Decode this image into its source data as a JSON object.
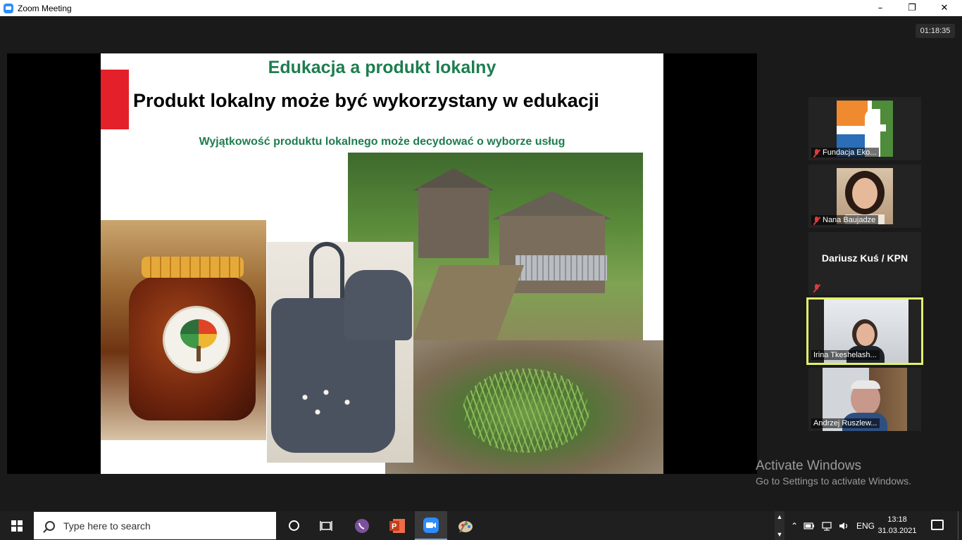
{
  "window": {
    "title": "Zoom Meeting",
    "minimize_icon": "minimize-icon",
    "restore_icon": "restore-icon",
    "close_icon": "close-icon"
  },
  "meeting": {
    "timer": "01:18:35"
  },
  "slide": {
    "title": "Edukacja a produkt lokalny",
    "heading": "Produkt lokalny może być wykorzystany w edukacji",
    "subtitle": "Wyjątkowość produktu lokalnego może decydować o wyborze usług",
    "accent_color": "#e4202a",
    "title_color": "#1e7d4f"
  },
  "participants": [
    {
      "name": "Fundacja Eko...",
      "muted": true,
      "video": "logo"
    },
    {
      "name": "Nana Baujadze",
      "muted": true,
      "video": "camera"
    },
    {
      "name": "Dariusz Kuś / KPN",
      "muted": true,
      "video": "off"
    },
    {
      "name": "Irina Tkeshelash...",
      "muted": false,
      "video": "camera",
      "active_speaker": true
    },
    {
      "name": "Andrzej Ruszlew...",
      "muted": false,
      "video": "camera"
    }
  ],
  "watermark": {
    "line1": "Activate Windows",
    "line2": "Go to Settings to activate Windows."
  },
  "taskbar": {
    "search_placeholder": "Type here to search",
    "language": "ENG",
    "time": "13:18",
    "date": "31.03.2021",
    "apps": [
      "task-view-icon",
      "viber-icon",
      "powerpoint-icon",
      "zoom-icon",
      "paint-icon"
    ]
  }
}
